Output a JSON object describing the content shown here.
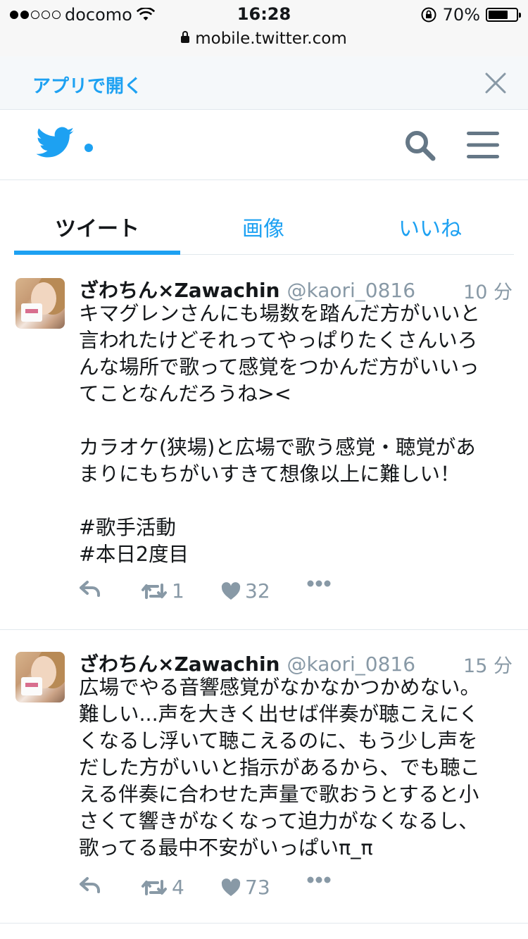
{
  "status_bar": {
    "carrier": "docomo",
    "signal_bars": 2,
    "time": "16:28",
    "battery": "70%",
    "battery_level": 0.7,
    "url": "mobile.twitter.com"
  },
  "app_banner": {
    "open_in_app": "アプリで開く"
  },
  "tabs": [
    {
      "label": "ツイート",
      "active": true
    },
    {
      "label": "画像",
      "active": false
    },
    {
      "label": "いいね",
      "active": false
    }
  ],
  "tweets": [
    {
      "name": "ざわちん×Zawachin",
      "handle": "@kaori_0816",
      "time": "10 分",
      "text": "キマグレンさんにも場数を踏んだ方がいいと\n言われたけどそれってやっぱりたくさんいろ\nんな場所で歌って感覚をつかんだ方がいいっ\nてことなんだろうね><\n\nカラオケ(狭場)と広場で歌う感覚・聴覚があ\nまりにもちがいすきて想像以上に難しい！\n\n#歌手活動\n#本日2度目",
      "retweets": "1",
      "likes": "32"
    },
    {
      "name": "ざわちん×Zawachin",
      "handle": "@kaori_0816",
      "time": "15 分",
      "text": "広場でやる音響感覚がなかなかつかめない。\n難しい...声を大きく出せば伴奏が聴こえにく\nくなるし浮いて聴こえるのに、もう少し声を\nだした方がいいと指示があるから、でも聴こ\nえる伴奏に合わせた声量で歌おうとすると小\nさくて響きがなくなって迫力がなくなるし、\n歌ってる最中不安がいっぱいπ_π",
      "retweets": "4",
      "likes": "73"
    }
  ],
  "colors": {
    "accent": "#1da1f2",
    "muted": "#8899a6",
    "text": "#14171a"
  },
  "icons": {
    "banner_close": "close-icon",
    "logo": "twitter-bird-icon",
    "search": "search-icon",
    "menu": "hamburger-menu-icon",
    "reply": "reply-icon",
    "retweet": "retweet-icon",
    "like": "heart-icon",
    "more": "more-dots-icon"
  }
}
